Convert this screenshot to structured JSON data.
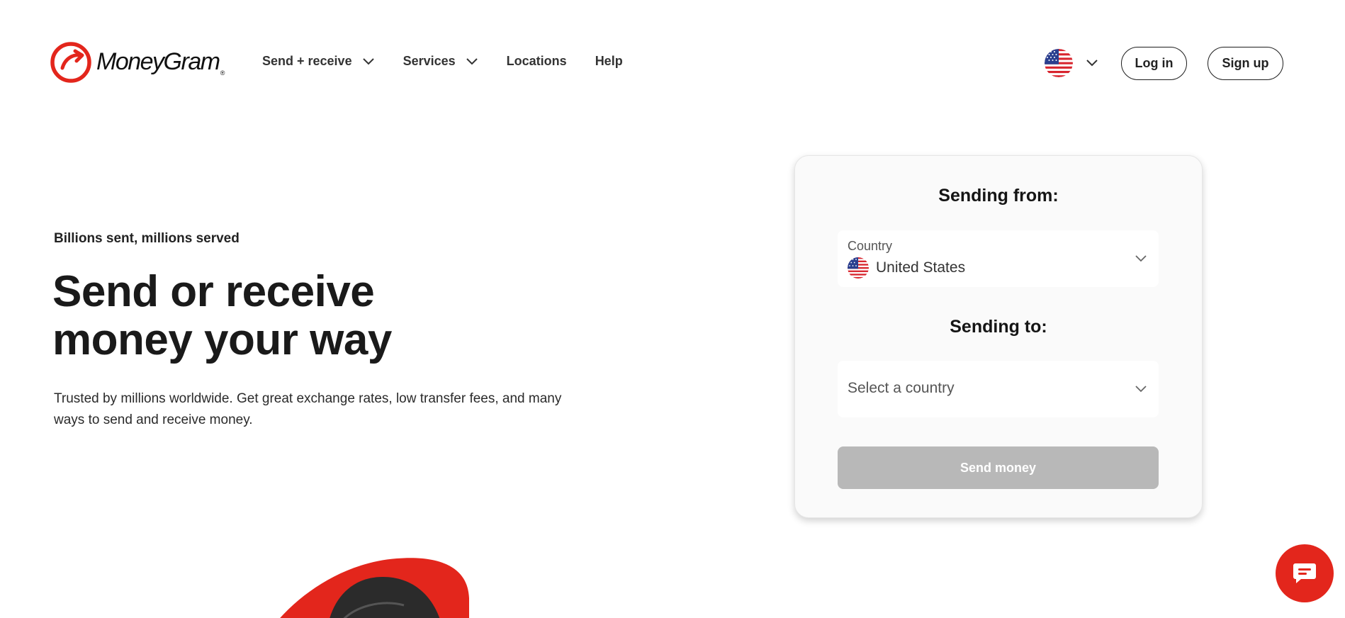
{
  "brand": {
    "name": "MoneyGram",
    "reg_mark": "®",
    "accent": "#e3261c"
  },
  "nav": {
    "items": [
      {
        "label": "Send + receive",
        "has_dropdown": true
      },
      {
        "label": "Services",
        "has_dropdown": true
      },
      {
        "label": "Locations",
        "has_dropdown": false
      },
      {
        "label": "Help",
        "has_dropdown": false
      }
    ],
    "locale_icon": "us-flag-icon",
    "login_label": "Log in",
    "signup_label": "Sign up"
  },
  "hero": {
    "eyebrow": "Billions sent, millions served",
    "title_line1": "Send or receive",
    "title_line2": "money your way",
    "subtitle_line1": "Trusted by millions worldwide. Get great exchange rates, low transfer fees, and many",
    "subtitle_line2": "ways to send and receive money."
  },
  "send_card": {
    "from_heading": "Sending from:",
    "from_field": {
      "label": "Country",
      "value": "United States",
      "icon": "us-flag-icon"
    },
    "to_heading": "Sending to:",
    "to_field": {
      "placeholder": "Select a country"
    },
    "submit_label": "Send money",
    "submit_disabled": true,
    "submit_color": "#b8b8b8"
  },
  "chat": {
    "icon": "chat-bubble-icon",
    "color": "#e3261c"
  }
}
